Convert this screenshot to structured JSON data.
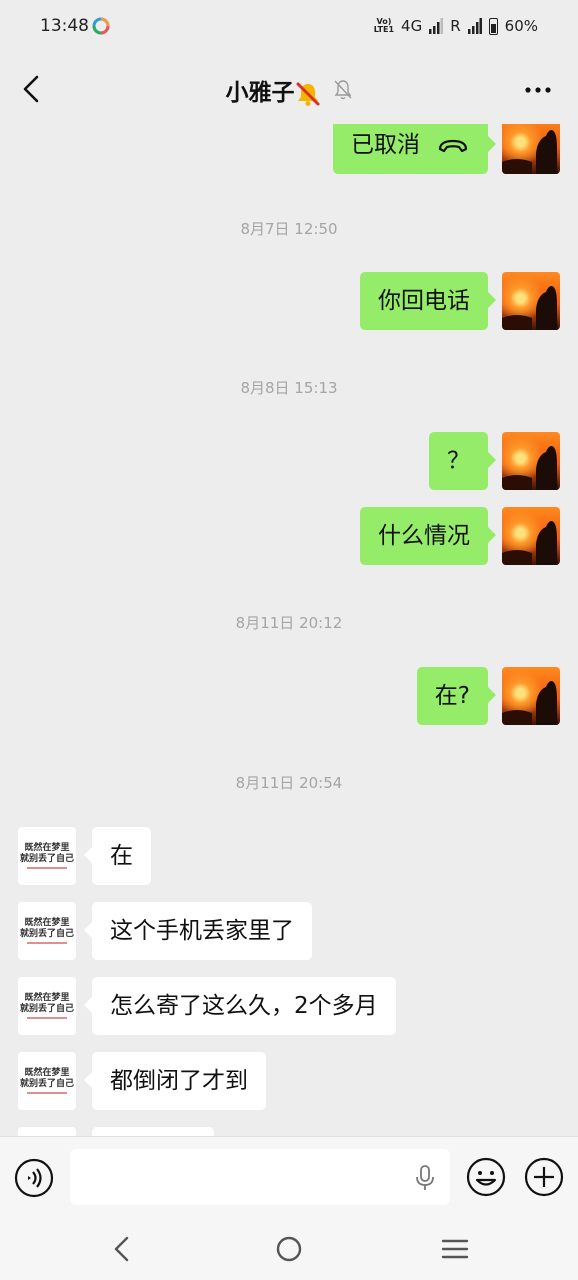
{
  "status_bar": {
    "time": "13:48",
    "volte": "VoLTE1",
    "network_1": "4G",
    "network_2": "R",
    "battery": "60%"
  },
  "header": {
    "title": "小雅子",
    "title_emoji": "bell-slash-emoji",
    "icons": [
      "back-icon",
      "mute-icon",
      "more-icon"
    ]
  },
  "messages": [
    {
      "type": "outgoing",
      "text": "已取消",
      "icon": "call-hangup-icon"
    },
    {
      "type": "timestamp",
      "text": "8月7日 12:50"
    },
    {
      "type": "outgoing",
      "text": "你回电话"
    },
    {
      "type": "timestamp",
      "text": "8月8日 15:13"
    },
    {
      "type": "outgoing",
      "text": "？"
    },
    {
      "type": "outgoing",
      "text": "什么情况"
    },
    {
      "type": "timestamp",
      "text": "8月11日 20:12"
    },
    {
      "type": "outgoing",
      "text": "在?"
    },
    {
      "type": "timestamp",
      "text": "8月11日 20:54"
    },
    {
      "type": "incoming",
      "text": "在"
    },
    {
      "type": "incoming",
      "text": "这个手机丢家里了"
    },
    {
      "type": "incoming",
      "text": "怎么寄了这么久，2个多月"
    },
    {
      "type": "incoming",
      "text": "都倒闭了才到"
    }
  ],
  "contact_avatar": {
    "line1": "既然在梦里",
    "line2": "就别丢了自己"
  },
  "colors": {
    "background": "#ededed",
    "outgoing_bubble": "#95ec69",
    "incoming_bubble": "#ffffff",
    "timestamp": "#a5a5a5"
  },
  "input_bar": {
    "icons": [
      "voice-icon",
      "mic-icon",
      "emoji-icon",
      "plus-icon"
    ]
  },
  "nav_bar": {
    "icons": [
      "nav-back-icon",
      "nav-home-icon",
      "nav-recent-icon"
    ]
  }
}
